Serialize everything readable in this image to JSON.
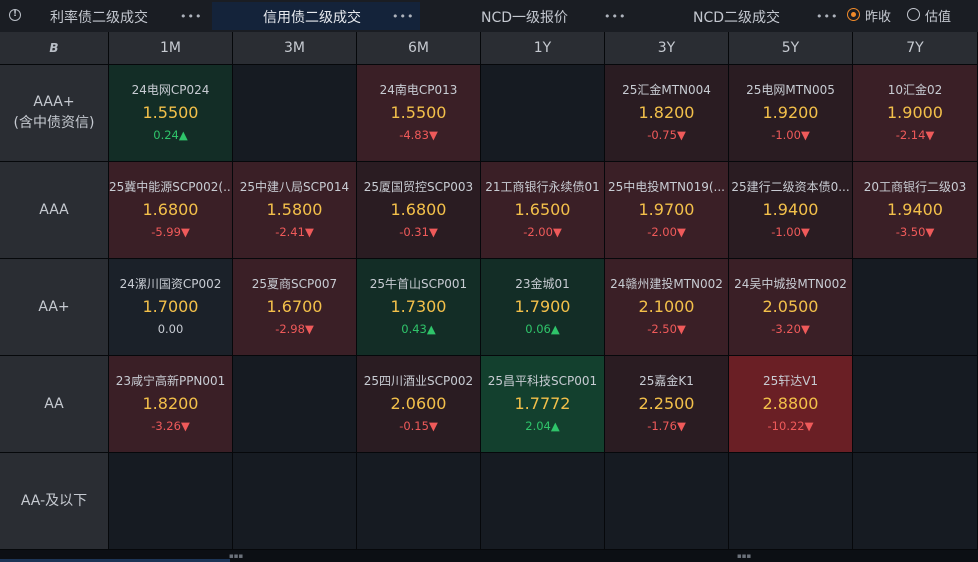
{
  "tabs": [
    {
      "label": "利率债二级成交",
      "active": false
    },
    {
      "label": "信用债二级成交",
      "active": true
    },
    {
      "label": "NCD一级报价",
      "active": false
    },
    {
      "label": "NCD二级成交",
      "active": false
    }
  ],
  "more_label": "•••",
  "radios": [
    {
      "label": "昨收",
      "selected": true
    },
    {
      "label": "估值",
      "selected": false
    }
  ],
  "corner_icon": "B",
  "columns": [
    "1M",
    "3M",
    "6M",
    "1Y",
    "3Y",
    "5Y",
    "7Y"
  ],
  "rows": [
    {
      "label": [
        "AAA+",
        "(含中债资信)"
      ],
      "cells": [
        {
          "name": "24电网CP024",
          "rate": "1.5500",
          "change": "0.24",
          "dir": "up",
          "bg": "g1"
        },
        null,
        {
          "name": "24南电CP013",
          "rate": "1.5500",
          "change": "-4.83",
          "dir": "down",
          "bg": "r2"
        },
        null,
        {
          "name": "25汇金MTN004",
          "rate": "1.8200",
          "change": "-0.75",
          "dir": "down",
          "bg": "r1"
        },
        {
          "name": "25电网MTN005",
          "rate": "1.9200",
          "change": "-1.00",
          "dir": "down",
          "bg": "r1"
        },
        {
          "name": "10汇金02",
          "rate": "1.9000",
          "change": "-2.14",
          "dir": "down",
          "bg": "r2"
        }
      ]
    },
    {
      "label": [
        "AAA"
      ],
      "cells": [
        {
          "name": "25冀中能源SCP002(...",
          "rate": "1.6800",
          "change": "-5.99",
          "dir": "down",
          "bg": "r2"
        },
        {
          "name": "25中建八局SCP014",
          "rate": "1.5800",
          "change": "-2.41",
          "dir": "down",
          "bg": "r2"
        },
        {
          "name": "25厦国贸控SCP003",
          "rate": "1.6800",
          "change": "-0.31",
          "dir": "down",
          "bg": "r1"
        },
        {
          "name": "21工商银行永续债01",
          "rate": "1.6500",
          "change": "-2.00",
          "dir": "down",
          "bg": "r2"
        },
        {
          "name": "25中电投MTN019(...",
          "rate": "1.9700",
          "change": "-2.00",
          "dir": "down",
          "bg": "r2"
        },
        {
          "name": "25建行二级资本债0...",
          "rate": "1.9400",
          "change": "-1.00",
          "dir": "down",
          "bg": "r1"
        },
        {
          "name": "20工商银行二级03",
          "rate": "1.9400",
          "change": "-3.50",
          "dir": "down",
          "bg": "r2"
        }
      ]
    },
    {
      "label": [
        "AA+"
      ],
      "cells": [
        {
          "name": "24漯川国资CP002",
          "rate": "1.7000",
          "change": "0.00",
          "dir": "flat",
          "bg": "n"
        },
        {
          "name": "25夏商SCP007",
          "rate": "1.6700",
          "change": "-2.98",
          "dir": "down",
          "bg": "r2"
        },
        {
          "name": "25牛首山SCP001",
          "rate": "1.7300",
          "change": "0.43",
          "dir": "up",
          "bg": "g1"
        },
        {
          "name": "23金城01",
          "rate": "1.7900",
          "change": "0.06",
          "dir": "up",
          "bg": "g1"
        },
        {
          "name": "24赣州建投MTN002",
          "rate": "2.1000",
          "change": "-2.50",
          "dir": "down",
          "bg": "r2"
        },
        {
          "name": "24吴中城投MTN002",
          "rate": "2.0500",
          "change": "-3.20",
          "dir": "down",
          "bg": "r2"
        },
        null
      ]
    },
    {
      "label": [
        "AA"
      ],
      "cells": [
        {
          "name": "23咸宁高新PPN001",
          "rate": "1.8200",
          "change": "-3.26",
          "dir": "down",
          "bg": "r2"
        },
        null,
        {
          "name": "25四川酒业SCP002",
          "rate": "2.0600",
          "change": "-0.15",
          "dir": "down",
          "bg": "r1"
        },
        {
          "name": "25昌平科技SCP001",
          "rate": "1.7772",
          "change": "2.04",
          "dir": "up",
          "bg": "g2"
        },
        {
          "name": "25嘉金K1",
          "rate": "2.2500",
          "change": "-1.76",
          "dir": "down",
          "bg": "r1"
        },
        {
          "name": "25轩达V1",
          "rate": "2.8800",
          "change": "-10.22",
          "dir": "down",
          "bg": "r3"
        },
        null
      ]
    },
    {
      "label": [
        "AA-及以下"
      ],
      "cells": [
        null,
        null,
        null,
        null,
        null,
        null,
        null
      ]
    }
  ],
  "colors": {
    "up": "#2fc46a",
    "down": "#ef5a5a",
    "rate": "#f3c04a",
    "accent": "#f08a2a"
  }
}
